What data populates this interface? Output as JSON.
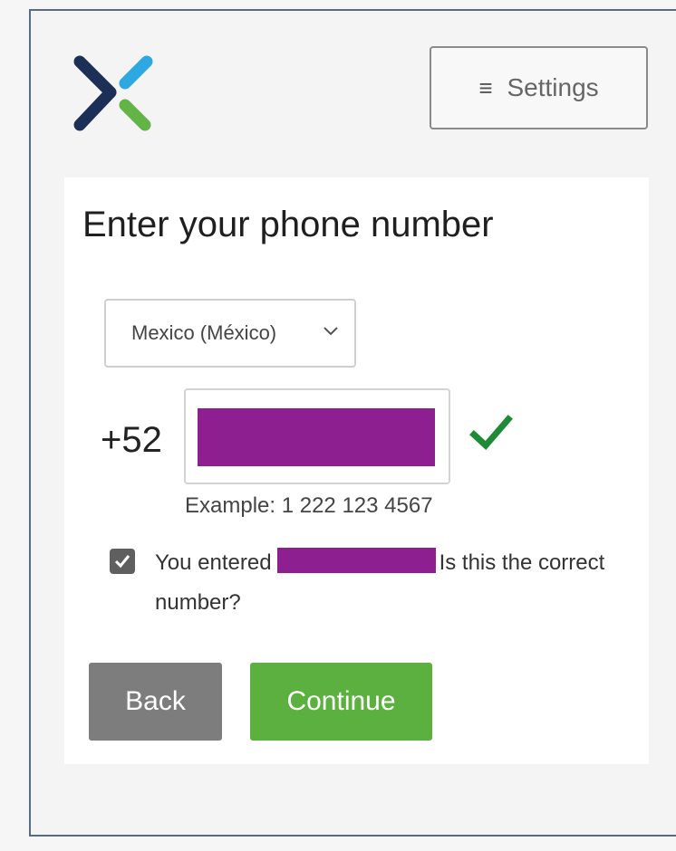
{
  "header": {
    "logo_icon": "x-brand-logo-icon",
    "settings_icon": "menu-icon",
    "settings_label": "Settings"
  },
  "form": {
    "title": "Enter your phone number",
    "country_select_value": "Mexico (México)",
    "dial_code": "+52",
    "phone_value_redacted": true,
    "validation_icon": "checkmark-icon",
    "example": "Example: 1 222 123 4567",
    "confirm_prefix": "You entered",
    "confirm_suffix": "Is this the correct number?",
    "confirm_checked": true,
    "back_label": "Back",
    "continue_label": "Continue"
  },
  "colors": {
    "brand_navy": "#1c2f57",
    "brand_blue": "#2ea8e0",
    "brand_green": "#62b447",
    "redaction": "#8e1f91",
    "valid_check": "#1f8a35",
    "back_button": "#7d7d7d",
    "continue_button": "#5cb03f"
  }
}
